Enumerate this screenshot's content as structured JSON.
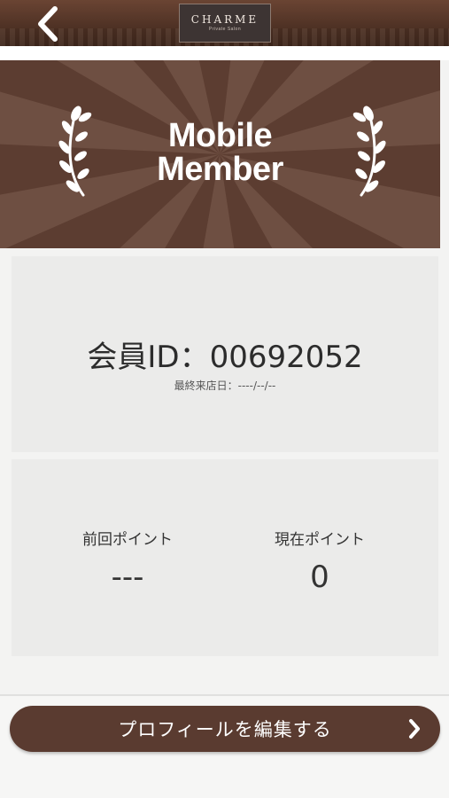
{
  "header": {
    "back_icon": "chevron-left-icon",
    "logo_brand": "CHARME",
    "logo_sub": "Private Salon"
  },
  "banner": {
    "title_line1": "Mobile",
    "title_line2": "Member",
    "icon_left": "laurel-icon",
    "icon_right": "laurel-icon",
    "colors": {
      "background": "#5c3d31",
      "rays": "#7a5a4c"
    }
  },
  "member": {
    "id_label": "会員ID：00692052",
    "last_visit": "最終来店日：----/--/--"
  },
  "points": {
    "previous_label": "前回ポイント",
    "previous_value": "---",
    "current_label": "現在ポイント",
    "current_value": "0"
  },
  "actions": {
    "edit_profile_label": "プロフィールを編集する",
    "edit_profile_icon": "chevron-right-icon"
  },
  "colors": {
    "brand_brown": "#5a3b30",
    "card": "#ebebea"
  }
}
